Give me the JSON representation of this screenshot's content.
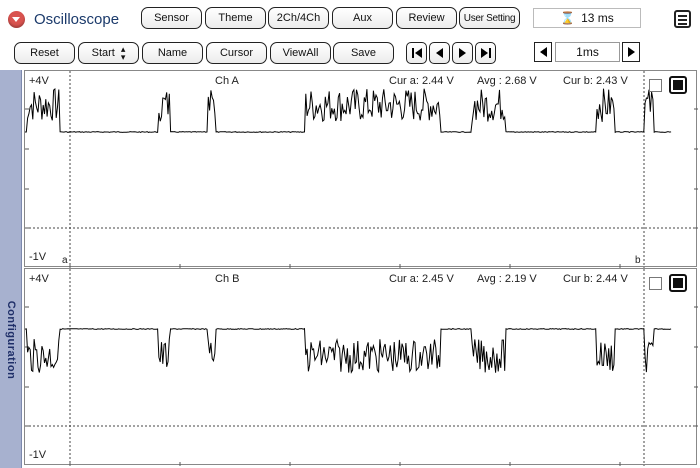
{
  "app": {
    "title": "Oscilloscope"
  },
  "header_tabs": [
    "Sensor",
    "Theme",
    "2Ch/4Ch",
    "Aux",
    "Review",
    "User Setting"
  ],
  "time_display": "13 ms",
  "toolbar": {
    "reset": "Reset",
    "start": "Start",
    "name": "Name",
    "cursor": "Cursor",
    "viewall": "ViewAll",
    "save": "Save"
  },
  "timebase": {
    "value": "1ms"
  },
  "side_tab": "Configuration",
  "channels": [
    {
      "name": "Ch A",
      "y_max": "+4V",
      "y_min": "-1V",
      "cur_a": "Cur a: 2.44 V",
      "avg": "Avg  : 2.68 V",
      "cur_b": "Cur b: 2.43 V",
      "cursor_a_label": "a",
      "cursor_b_label": "b",
      "polarity": "high"
    },
    {
      "name": "Ch B",
      "y_max": "+4V",
      "y_min": "-1V",
      "cur_a": "Cur a: 2.45 V",
      "avg": "Avg  : 2.19 V",
      "cur_b": "Cur b: 2.44 V",
      "polarity": "low"
    }
  ]
}
